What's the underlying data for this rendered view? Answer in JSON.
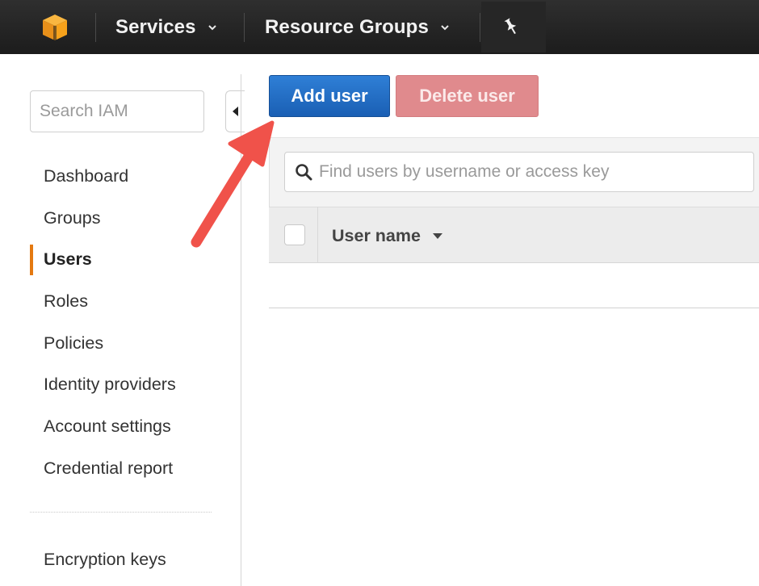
{
  "topbar": {
    "services_label": "Services",
    "resource_groups_label": "Resource Groups",
    "icons": {
      "logo": "aws-cube-icon",
      "caret": "chevron-down-icon",
      "pin": "pushpin-icon"
    },
    "colors": {
      "background": "#232323",
      "logo": "#f7a21b"
    }
  },
  "sidebar": {
    "search_placeholder": "Search IAM",
    "items": [
      {
        "label": "Dashboard"
      },
      {
        "label": "Groups"
      },
      {
        "label": "Users",
        "active": true
      },
      {
        "label": "Roles"
      },
      {
        "label": "Policies"
      },
      {
        "label": "Identity providers"
      },
      {
        "label": "Account settings"
      },
      {
        "label": "Credential report"
      }
    ],
    "bottom_items": [
      {
        "label": "Encryption keys"
      }
    ],
    "colors": {
      "active_indicator": "#e47911"
    }
  },
  "toolbar": {
    "add_user_label": "Add user",
    "delete_user_label": "Delete user",
    "colors": {
      "add_user": "#1f6cc4",
      "delete_user": "#e08a8d"
    }
  },
  "users_table": {
    "search_placeholder": "Find users by username or access key",
    "columns": [
      {
        "label": "User name",
        "sort": "descending"
      }
    ],
    "rows": []
  },
  "annotation": {
    "arrow_color": "#f0524a",
    "points_to": "add-user-button"
  }
}
